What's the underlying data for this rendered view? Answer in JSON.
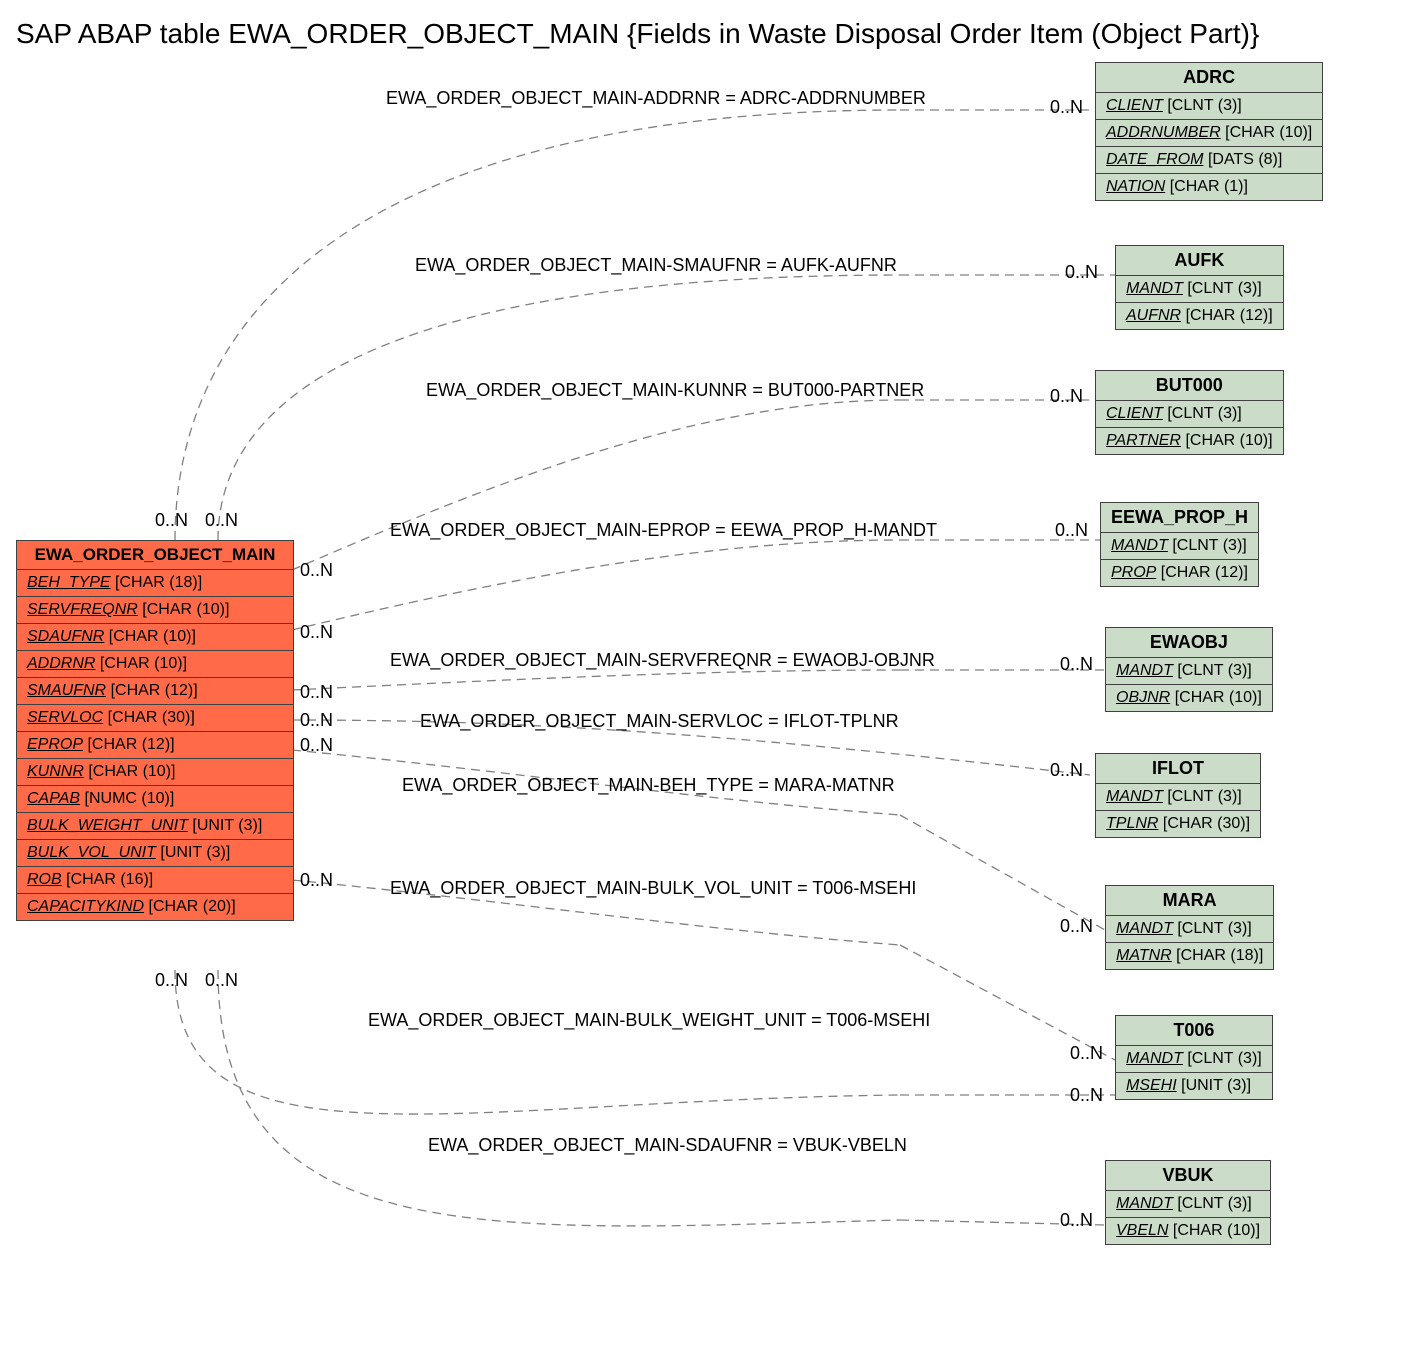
{
  "title": "SAP ABAP table EWA_ORDER_OBJECT_MAIN {Fields in Waste Disposal Order Item (Object Part)}",
  "main": {
    "name": "EWA_ORDER_OBJECT_MAIN",
    "fields": [
      {
        "name": "BEH_TYPE",
        "type": "[CHAR (18)]"
      },
      {
        "name": "SERVFREQNR",
        "type": "[CHAR (10)]"
      },
      {
        "name": "SDAUFNR",
        "type": "[CHAR (10)]"
      },
      {
        "name": "ADDRNR",
        "type": "[CHAR (10)]"
      },
      {
        "name": "SMAUFNR",
        "type": "[CHAR (12)]"
      },
      {
        "name": "SERVLOC",
        "type": "[CHAR (30)]"
      },
      {
        "name": "EPROP",
        "type": "[CHAR (12)]"
      },
      {
        "name": "KUNNR",
        "type": "[CHAR (10)]"
      },
      {
        "name": "CAPAB",
        "type": "[NUMC (10)]"
      },
      {
        "name": "BULK_WEIGHT_UNIT",
        "type": "[UNIT (3)]"
      },
      {
        "name": "BULK_VOL_UNIT",
        "type": "[UNIT (3)]"
      },
      {
        "name": "ROB",
        "type": "[CHAR (16)]"
      },
      {
        "name": "CAPACITYKIND",
        "type": "[CHAR (20)]"
      }
    ]
  },
  "targets": {
    "adrc": {
      "name": "ADRC",
      "fields": [
        {
          "name": "CLIENT",
          "type": "[CLNT (3)]"
        },
        {
          "name": "ADDRNUMBER",
          "type": "[CHAR (10)]"
        },
        {
          "name": "DATE_FROM",
          "type": "[DATS (8)]"
        },
        {
          "name": "NATION",
          "type": "[CHAR (1)]"
        }
      ]
    },
    "aufk": {
      "name": "AUFK",
      "fields": [
        {
          "name": "MANDT",
          "type": "[CLNT (3)]"
        },
        {
          "name": "AUFNR",
          "type": "[CHAR (12)]"
        }
      ]
    },
    "but000": {
      "name": "BUT000",
      "fields": [
        {
          "name": "CLIENT",
          "type": "[CLNT (3)]"
        },
        {
          "name": "PARTNER",
          "type": "[CHAR (10)]"
        }
      ]
    },
    "eewa": {
      "name": "EEWA_PROP_H",
      "fields": [
        {
          "name": "MANDT",
          "type": "[CLNT (3)]"
        },
        {
          "name": "PROP",
          "type": "[CHAR (12)]"
        }
      ]
    },
    "ewaobj": {
      "name": "EWAOBJ",
      "fields": [
        {
          "name": "MANDT",
          "type": "[CLNT (3)]"
        },
        {
          "name": "OBJNR",
          "type": "[CHAR (10)]"
        }
      ]
    },
    "iflot": {
      "name": "IFLOT",
      "fields": [
        {
          "name": "MANDT",
          "type": "[CLNT (3)]"
        },
        {
          "name": "TPLNR",
          "type": "[CHAR (30)]"
        }
      ]
    },
    "mara": {
      "name": "MARA",
      "fields": [
        {
          "name": "MANDT",
          "type": "[CLNT (3)]"
        },
        {
          "name": "MATNR",
          "type": "[CHAR (18)]"
        }
      ]
    },
    "t006": {
      "name": "T006",
      "fields": [
        {
          "name": "MANDT",
          "type": "[CLNT (3)]"
        },
        {
          "name": "MSEHI",
          "type": "[UNIT (3)]"
        }
      ]
    },
    "vbuk": {
      "name": "VBUK",
      "fields": [
        {
          "name": "MANDT",
          "type": "[CLNT (3)]"
        },
        {
          "name": "VBELN",
          "type": "[CHAR (10)]"
        }
      ]
    }
  },
  "edges": {
    "e0": "EWA_ORDER_OBJECT_MAIN-ADDRNR = ADRC-ADDRNUMBER",
    "e1": "EWA_ORDER_OBJECT_MAIN-SMAUFNR = AUFK-AUFNR",
    "e2": "EWA_ORDER_OBJECT_MAIN-KUNNR = BUT000-PARTNER",
    "e3": "EWA_ORDER_OBJECT_MAIN-EPROP = EEWA_PROP_H-MANDT",
    "e4": "EWA_ORDER_OBJECT_MAIN-SERVFREQNR = EWAOBJ-OBJNR",
    "e5": "EWA_ORDER_OBJECT_MAIN-SERVLOC = IFLOT-TPLNR",
    "e6": "EWA_ORDER_OBJECT_MAIN-BEH_TYPE = MARA-MATNR",
    "e7": "EWA_ORDER_OBJECT_MAIN-BULK_VOL_UNIT = T006-MSEHI",
    "e8": "EWA_ORDER_OBJECT_MAIN-BULK_WEIGHT_UNIT = T006-MSEHI",
    "e9": "EWA_ORDER_OBJECT_MAIN-SDAUFNR = VBUK-VBELN"
  },
  "card": "0..N"
}
